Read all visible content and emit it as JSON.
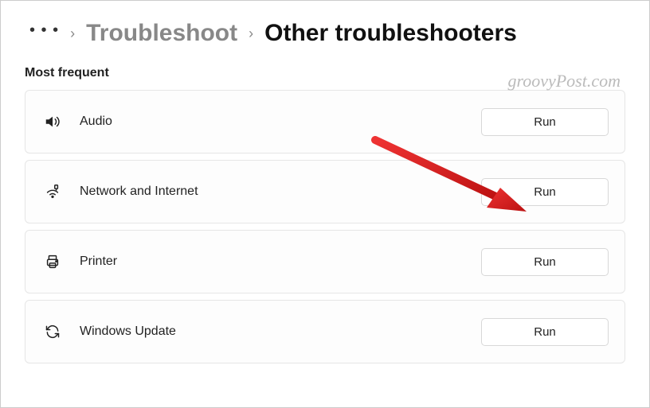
{
  "breadcrumb": {
    "ellipsis": "• • •",
    "sep": "›",
    "link": "Troubleshoot",
    "current": "Other troubleshooters"
  },
  "section_title": "Most frequent",
  "watermark": "groovyPost.com",
  "items": [
    {
      "label": "Audio",
      "button": "Run"
    },
    {
      "label": "Network and Internet",
      "button": "Run"
    },
    {
      "label": "Printer",
      "button": "Run"
    },
    {
      "label": "Windows Update",
      "button": "Run"
    }
  ]
}
